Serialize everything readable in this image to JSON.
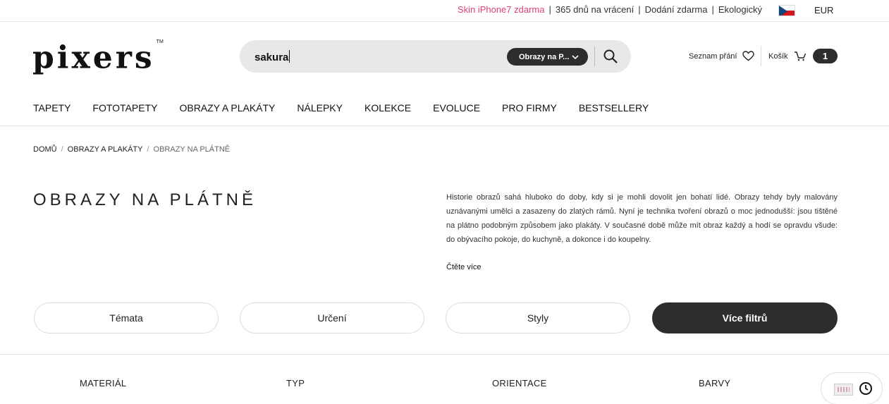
{
  "topbar": {
    "promo": "Skin iPhone7 zdarma",
    "links": [
      "365 dnů na vrácení",
      "Dodání zdarma",
      "Ekologický"
    ],
    "separator": "|",
    "currency": "EUR",
    "flag_icon": "czech-flag-icon"
  },
  "header": {
    "logo": "pixers",
    "logo_tm": "TM",
    "search": {
      "query": "sakura",
      "scope": "Obrazy na P..."
    },
    "wishlist_label": "Seznam přání",
    "cart_label": "Košík",
    "cart_count": "1"
  },
  "nav": {
    "items": [
      "TAPETY",
      "FOTOTAPETY",
      "OBRAZY A PLAKÁTY",
      "NÁLEPKY",
      "KOLEKCE",
      "EVOLUCE",
      "PRO FIRMY",
      "BESTSELLERY"
    ]
  },
  "breadcrumb": {
    "items": [
      "DOMŮ",
      "OBRAZY A PLAKÁTY",
      "OBRAZY NA PLÁTNĚ"
    ],
    "separator": "/"
  },
  "page": {
    "title": "OBRAZY NA PLÁTNĚ",
    "description": "Historie obrazů sahá hluboko do doby, kdy si je mohli dovolit jen bohatí lidé. Obrazy tehdy byly malovány uznávanými umělci a zasazeny do zlatých rámů. Nyní je technika tvoření obrazů o moc jednodušší: jsou tištěné na plátno podobným způsobem jako plakáty. V současné době může mít obraz každý a hodí se opravdu všude: do obývacího pokoje, do kuchyně, a dokonce i do koupelny.",
    "read_more": "Čtěte více"
  },
  "filters": {
    "pills": [
      "Témata",
      "Určení",
      "Styly",
      "Více filtrů"
    ],
    "headers": [
      "MATERIÁL",
      "TYP",
      "ORIENTACE",
      "BARVY"
    ]
  },
  "colors": {
    "promo": "#e0407b",
    "dark": "#2d2d2d",
    "search_bg": "#e8e8e8"
  }
}
